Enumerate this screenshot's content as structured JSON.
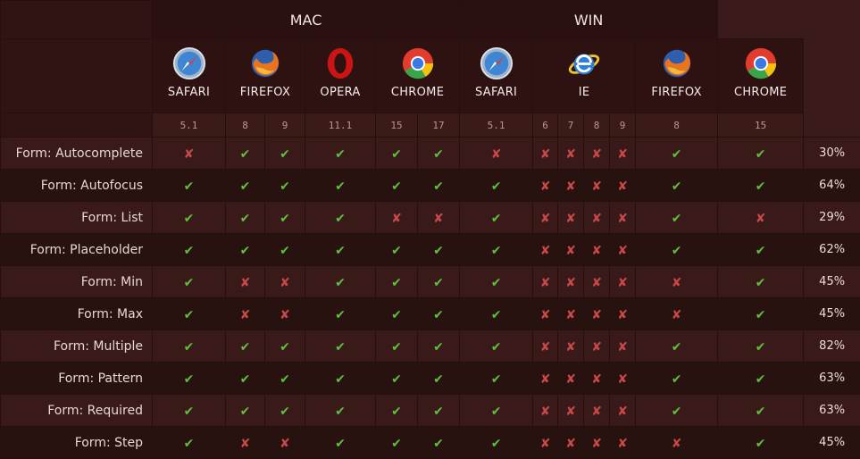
{
  "os_groups": {
    "mac": "MAC",
    "win": "WIN"
  },
  "browsers": {
    "mac_safari": "SAFARI",
    "mac_firefox": "FIREFOX",
    "mac_opera": "OPERA",
    "mac_chrome": "CHROME",
    "win_safari": "SAFARI",
    "win_ie": "IE",
    "win_firefox": "FIREFOX",
    "win_chrome": "CHROME"
  },
  "versions": [
    "5.1",
    "8",
    "9",
    "11.1",
    "15",
    "17",
    "5.1",
    "6",
    "7",
    "8",
    "9",
    "8",
    "15"
  ],
  "features": [
    {
      "name": "Form: Autocomplete",
      "support": [
        0,
        1,
        1,
        1,
        1,
        1,
        0,
        0,
        0,
        0,
        0,
        1,
        1
      ],
      "pct": "30%"
    },
    {
      "name": "Form: Autofocus",
      "support": [
        1,
        1,
        1,
        1,
        1,
        1,
        1,
        0,
        0,
        0,
        0,
        1,
        1
      ],
      "pct": "64%"
    },
    {
      "name": "Form: List",
      "support": [
        1,
        1,
        1,
        1,
        0,
        0,
        1,
        0,
        0,
        0,
        0,
        1,
        0
      ],
      "pct": "29%"
    },
    {
      "name": "Form: Placeholder",
      "support": [
        1,
        1,
        1,
        1,
        1,
        1,
        1,
        0,
        0,
        0,
        0,
        1,
        1
      ],
      "pct": "62%"
    },
    {
      "name": "Form: Min",
      "support": [
        1,
        0,
        0,
        1,
        1,
        1,
        1,
        0,
        0,
        0,
        0,
        0,
        1
      ],
      "pct": "45%"
    },
    {
      "name": "Form: Max",
      "support": [
        1,
        0,
        0,
        1,
        1,
        1,
        1,
        0,
        0,
        0,
        0,
        0,
        1
      ],
      "pct": "45%"
    },
    {
      "name": "Form: Multiple",
      "support": [
        1,
        1,
        1,
        1,
        1,
        1,
        1,
        0,
        0,
        0,
        0,
        1,
        1
      ],
      "pct": "82%"
    },
    {
      "name": "Form: Pattern",
      "support": [
        1,
        1,
        1,
        1,
        1,
        1,
        1,
        0,
        0,
        0,
        0,
        1,
        1
      ],
      "pct": "63%"
    },
    {
      "name": "Form: Required",
      "support": [
        1,
        1,
        1,
        1,
        1,
        1,
        1,
        0,
        0,
        0,
        0,
        1,
        1
      ],
      "pct": "63%"
    },
    {
      "name": "Form: Step",
      "support": [
        1,
        0,
        0,
        1,
        1,
        1,
        1,
        0,
        0,
        0,
        0,
        0,
        1
      ],
      "pct": "45%"
    }
  ],
  "marks": {
    "yes": "✔",
    "no": "✘"
  },
  "icons": {
    "safari": "safari-icon",
    "firefox": "firefox-icon",
    "opera": "opera-icon",
    "chrome": "chrome-icon",
    "ie": "ie-icon"
  },
  "colors": {
    "yes": "#5fbf3f",
    "no": "#c94848"
  }
}
